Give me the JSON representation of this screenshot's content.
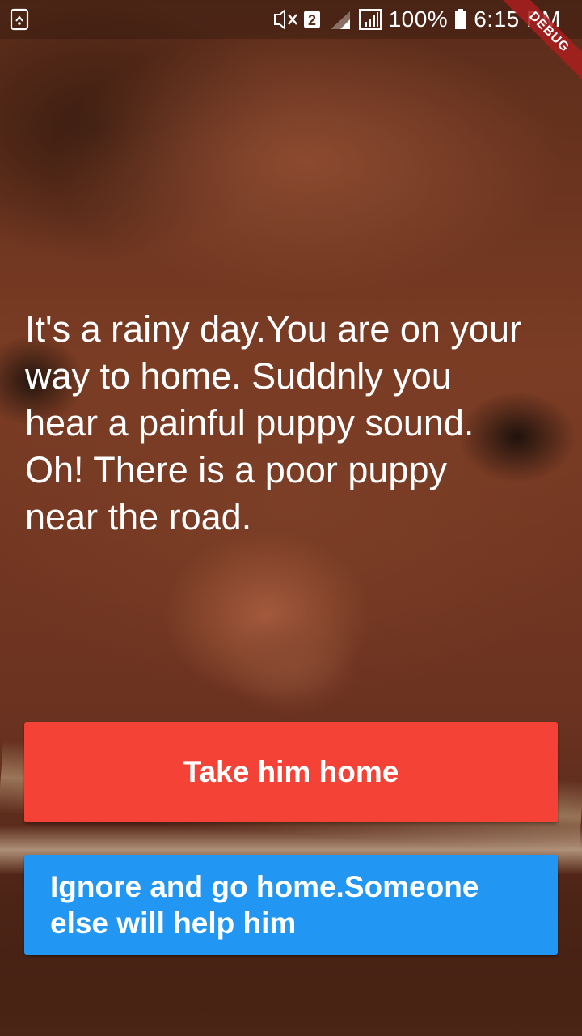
{
  "status_bar": {
    "sim_badge": "2",
    "battery_text": "100%",
    "time": "6:15 PM",
    "icons": [
      "screenshot-icon",
      "mute-icon",
      "sim-2-signal-icon",
      "signal-icon",
      "battery-icon"
    ]
  },
  "debug_banner": "DEBUG",
  "story": {
    "text": "It's a rainy day.You are on your way to home. Suddnly you hear a painful puppy sound. Oh! There is a poor puppy near the road."
  },
  "choices": {
    "take_home_label": "Take him home",
    "ignore_label": "Ignore and go home.Someone else will help him"
  },
  "colors": {
    "take_button": "#f44336",
    "ignore_button": "#2196f3",
    "text": "#ffffff"
  }
}
